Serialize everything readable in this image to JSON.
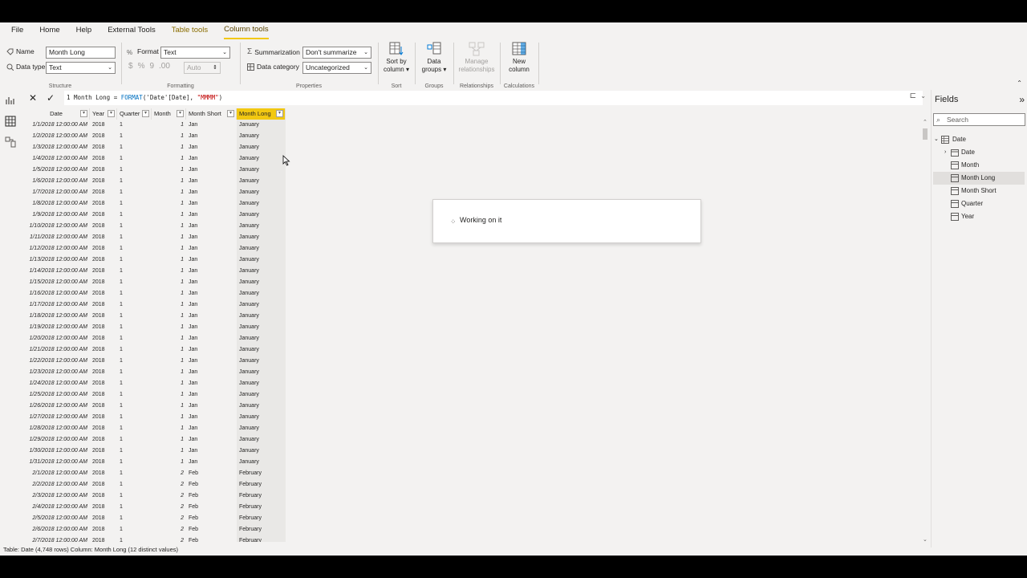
{
  "menu": [
    "File",
    "Home",
    "Help",
    "External Tools",
    "Table tools",
    "Column tools"
  ],
  "ribbon": {
    "structure": {
      "label": "Structure",
      "name_label": "Name",
      "name_value": "Month Long",
      "datatype_label": "Data type",
      "datatype_value": "Text"
    },
    "formatting": {
      "label": "Formatting",
      "format_label": "Format",
      "format_value": "Text",
      "auto_value": "Auto",
      "currency": "$",
      "percent": "%",
      "comma": "9",
      "decimal": ".00"
    },
    "properties": {
      "label": "Properties",
      "summarization_label": "Summarization",
      "summarization_value": "Don't summarize",
      "category_label": "Data category",
      "category_value": "Uncategorized"
    },
    "sort": {
      "label": "Sort",
      "button": "Sort by column"
    },
    "groups": {
      "label": "Groups",
      "button": "Data groups"
    },
    "relationships": {
      "label": "Relationships",
      "button": "Manage relationships"
    },
    "calculations": {
      "label": "Calculations",
      "button": "New column"
    }
  },
  "formula": {
    "line_no": "1",
    "prefix": "Month Long = ",
    "fn": "FORMAT",
    "args": "('Date'[Date], ",
    "str": "\"MMMM\"",
    "close": ")"
  },
  "columns": [
    "Date",
    "Year",
    "Quarter",
    "Month",
    "Month Short",
    "Month Long"
  ],
  "rows": [
    [
      "1/1/2018 12:00:00 AM",
      "2018",
      "1",
      "1",
      "Jan",
      "January"
    ],
    [
      "1/2/2018 12:00:00 AM",
      "2018",
      "1",
      "1",
      "Jan",
      "January"
    ],
    [
      "1/3/2018 12:00:00 AM",
      "2018",
      "1",
      "1",
      "Jan",
      "January"
    ],
    [
      "1/4/2018 12:00:00 AM",
      "2018",
      "1",
      "1",
      "Jan",
      "January"
    ],
    [
      "1/5/2018 12:00:00 AM",
      "2018",
      "1",
      "1",
      "Jan",
      "January"
    ],
    [
      "1/6/2018 12:00:00 AM",
      "2018",
      "1",
      "1",
      "Jan",
      "January"
    ],
    [
      "1/7/2018 12:00:00 AM",
      "2018",
      "1",
      "1",
      "Jan",
      "January"
    ],
    [
      "1/8/2018 12:00:00 AM",
      "2018",
      "1",
      "1",
      "Jan",
      "January"
    ],
    [
      "1/9/2018 12:00:00 AM",
      "2018",
      "1",
      "1",
      "Jan",
      "January"
    ],
    [
      "1/10/2018 12:00:00 AM",
      "2018",
      "1",
      "1",
      "Jan",
      "January"
    ],
    [
      "1/11/2018 12:00:00 AM",
      "2018",
      "1",
      "1",
      "Jan",
      "January"
    ],
    [
      "1/12/2018 12:00:00 AM",
      "2018",
      "1",
      "1",
      "Jan",
      "January"
    ],
    [
      "1/13/2018 12:00:00 AM",
      "2018",
      "1",
      "1",
      "Jan",
      "January"
    ],
    [
      "1/14/2018 12:00:00 AM",
      "2018",
      "1",
      "1",
      "Jan",
      "January"
    ],
    [
      "1/15/2018 12:00:00 AM",
      "2018",
      "1",
      "1",
      "Jan",
      "January"
    ],
    [
      "1/16/2018 12:00:00 AM",
      "2018",
      "1",
      "1",
      "Jan",
      "January"
    ],
    [
      "1/17/2018 12:00:00 AM",
      "2018",
      "1",
      "1",
      "Jan",
      "January"
    ],
    [
      "1/18/2018 12:00:00 AM",
      "2018",
      "1",
      "1",
      "Jan",
      "January"
    ],
    [
      "1/19/2018 12:00:00 AM",
      "2018",
      "1",
      "1",
      "Jan",
      "January"
    ],
    [
      "1/20/2018 12:00:00 AM",
      "2018",
      "1",
      "1",
      "Jan",
      "January"
    ],
    [
      "1/21/2018 12:00:00 AM",
      "2018",
      "1",
      "1",
      "Jan",
      "January"
    ],
    [
      "1/22/2018 12:00:00 AM",
      "2018",
      "1",
      "1",
      "Jan",
      "January"
    ],
    [
      "1/23/2018 12:00:00 AM",
      "2018",
      "1",
      "1",
      "Jan",
      "January"
    ],
    [
      "1/24/2018 12:00:00 AM",
      "2018",
      "1",
      "1",
      "Jan",
      "January"
    ],
    [
      "1/25/2018 12:00:00 AM",
      "2018",
      "1",
      "1",
      "Jan",
      "January"
    ],
    [
      "1/26/2018 12:00:00 AM",
      "2018",
      "1",
      "1",
      "Jan",
      "January"
    ],
    [
      "1/27/2018 12:00:00 AM",
      "2018",
      "1",
      "1",
      "Jan",
      "January"
    ],
    [
      "1/28/2018 12:00:00 AM",
      "2018",
      "1",
      "1",
      "Jan",
      "January"
    ],
    [
      "1/29/2018 12:00:00 AM",
      "2018",
      "1",
      "1",
      "Jan",
      "January"
    ],
    [
      "1/30/2018 12:00:00 AM",
      "2018",
      "1",
      "1",
      "Jan",
      "January"
    ],
    [
      "1/31/2018 12:00:00 AM",
      "2018",
      "1",
      "1",
      "Jan",
      "January"
    ],
    [
      "2/1/2018 12:00:00 AM",
      "2018",
      "1",
      "2",
      "Feb",
      "February"
    ],
    [
      "2/2/2018 12:00:00 AM",
      "2018",
      "1",
      "2",
      "Feb",
      "February"
    ],
    [
      "2/3/2018 12:00:00 AM",
      "2018",
      "1",
      "2",
      "Feb",
      "February"
    ],
    [
      "2/4/2018 12:00:00 AM",
      "2018",
      "1",
      "2",
      "Feb",
      "February"
    ],
    [
      "2/5/2018 12:00:00 AM",
      "2018",
      "1",
      "2",
      "Feb",
      "February"
    ],
    [
      "2/6/2018 12:00:00 AM",
      "2018",
      "1",
      "2",
      "Feb",
      "February"
    ],
    [
      "2/7/2018 12:00:00 AM",
      "2018",
      "1",
      "2",
      "Feb",
      "February"
    ]
  ],
  "dialog": {
    "message": "Working on it"
  },
  "fields_pane": {
    "title": "Fields",
    "search_placeholder": "Search",
    "table": "Date",
    "items": [
      "Date",
      "Month",
      "Month Long",
      "Month Short",
      "Quarter",
      "Year"
    ],
    "selected": "Month Long"
  },
  "status": "Table: Date (4,748 rows) Column: Month Long (12 distinct values)",
  "colors": {
    "accent": "#f2c811",
    "background": "#f3f2f1",
    "selected_tree": "#e1dfdd"
  }
}
